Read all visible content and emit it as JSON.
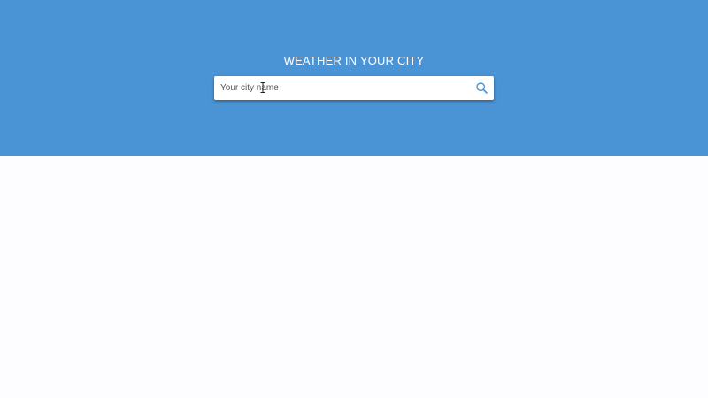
{
  "header": {
    "title": "WEATHER IN YOUR CITY"
  },
  "search": {
    "placeholder": "Your city name",
    "value": "",
    "icon": "search-icon"
  },
  "colors": {
    "hero_background": "#4a94d6",
    "page_background": "#fdfcff",
    "accent": "#4a94d6"
  }
}
